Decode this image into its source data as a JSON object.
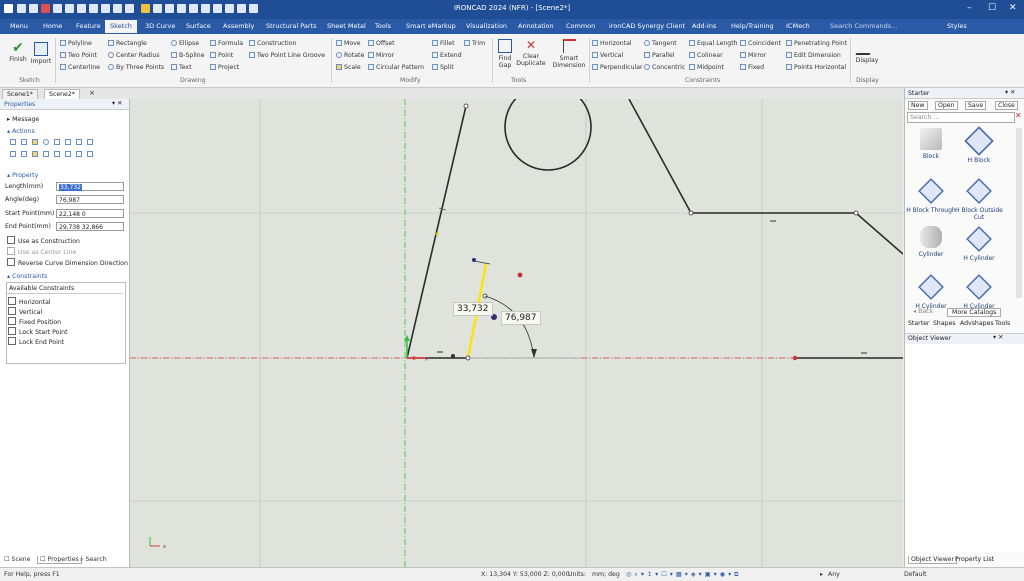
{
  "window": {
    "title": "IRONCAD 2024 (NFR) - [Scene2*]",
    "styles_label": "Styles",
    "minimize": "–",
    "maximize": "☐",
    "close": "✕"
  },
  "menu_tabs": [
    "Menu",
    "Home",
    "Feature",
    "Sketch",
    "3D Curve",
    "Surface",
    "Assembly",
    "Structural Parts",
    "Sheet Metal",
    "Tools",
    "Smart eMarkup",
    "Visualization",
    "Annotation",
    "Common",
    "ironCAD Synergy Client",
    "Add-Ins",
    "Help/Training",
    "ICMech"
  ],
  "active_tab": "Sketch",
  "search_placeholder": "Search Commands...",
  "ribbon": {
    "finish": "Finish",
    "import": "Import",
    "drawing": {
      "col1": [
        "Polyline",
        "Two Point",
        "Centerline"
      ],
      "col2": [
        "Rectangle",
        "Center Radius",
        "By Three Points"
      ],
      "col3": [
        "Ellipse",
        "B-Spline",
        "Text"
      ],
      "col4": [
        "Formula",
        "Point",
        "Project"
      ],
      "col5": [
        "Construction",
        "Two Point Line Groove"
      ]
    },
    "modify": {
      "col1": [
        "Move",
        "Rotate",
        "Scale"
      ],
      "col2": [
        "Offset",
        "Mirror",
        "Circular Pattern"
      ],
      "col3": [
        "Fillet",
        "Extend",
        "Split"
      ],
      "col4": [
        "Trim"
      ]
    },
    "tools": {
      "find_gap": "Find Gap",
      "clear_duplicate": "Clear Duplicate",
      "smart_dimension": "Smart Dimension"
    },
    "constraints": {
      "col1": [
        "Horizontal",
        "Vertical",
        "Perpendicular"
      ],
      "col2": [
        "Tangent",
        "Parallel",
        "Concentric"
      ],
      "col3": [
        "Equal Length",
        "Colinear",
        "Midpoint"
      ],
      "col4": [
        "Coincident",
        "Mirror",
        "Fixed"
      ],
      "col5": [
        "Penetrating Point",
        "Edit Dimension",
        "Points Horizontal"
      ]
    },
    "display": "Display",
    "groups": [
      "Sketch",
      "Drawing",
      "Modify",
      "Tools",
      "Constraints",
      "Display"
    ]
  },
  "doc_tabs": [
    "Scene1*",
    "Scene2*"
  ],
  "properties_panel": {
    "title": "Properties",
    "message": "Message",
    "actions": "Actions",
    "property": "Property",
    "fields": [
      {
        "label": "Length(mm)",
        "value": "33,732"
      },
      {
        "label": "Angle(deg)",
        "value": "76,987"
      },
      {
        "label": "Start Point(mm)",
        "value": "22,148 0"
      },
      {
        "label": "End Point(mm)",
        "value": "29,738 32,866"
      }
    ],
    "checks": [
      "Use as Construction",
      "Use as Center Line",
      "Reverse Curve Dimension Direction"
    ],
    "constraints_title": "Constraints",
    "available_constraints": "Available Constraints",
    "constraint_items": [
      "Horizontal",
      "Vertical",
      "Fixed Position",
      "Lock Start Point",
      "Lock End Point"
    ]
  },
  "viewport": {
    "dim_length": "33,732",
    "dim_angle": "76,987",
    "accent": "#ffe400",
    "axis_red": "#e04040",
    "axis_green": "#30c040"
  },
  "catalog": {
    "title": "Starter",
    "buttons": [
      "New",
      "Open",
      "Save",
      "Close"
    ],
    "search": "Search ...",
    "items": [
      "Block",
      "H Block",
      "H Block Through",
      "H Block Outside Cut",
      "Cylinder",
      "H Cylinder",
      "H Cylinder",
      "H Cylinder"
    ],
    "back": "Back",
    "more": "More Catalogs",
    "tabs": [
      "Starter",
      "Shapes",
      "Advshapes",
      "Tools"
    ]
  },
  "object_viewer": {
    "title": "Object Viewer",
    "tabs": [
      "Object Viewer",
      "Property List"
    ]
  },
  "bottom_tabs": [
    "Scene",
    "Properties",
    "Search"
  ],
  "status": {
    "help": "For Help, press F1",
    "coords": "X: 13,304 Y: 53,000 Z: 0,000",
    "units_label": "Units:",
    "units_value": "mm; deg",
    "filter": "Any",
    "style": "Default"
  }
}
